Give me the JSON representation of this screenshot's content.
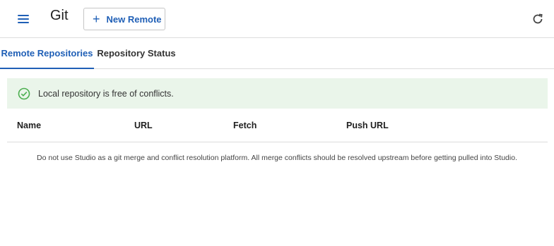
{
  "header": {
    "menu_icon": "hamburger-menu-icon",
    "title": "Git",
    "new_remote_icon": "plus-icon",
    "new_remote_label": "New Remote",
    "refresh_icon": "refresh-icon"
  },
  "tabs": [
    {
      "label": "Remote Repositories",
      "active": true
    },
    {
      "label": "Repository Status",
      "active": false
    }
  ],
  "alert": {
    "icon": "check-circle-icon",
    "message": "Local repository is free of conflicts.",
    "color": "#4caf50"
  },
  "table": {
    "columns": [
      "Name",
      "URL",
      "Fetch",
      "Push URL"
    ],
    "rows": []
  },
  "note": "Do not use Studio as a git merge and conflict resolution platform. All merge conflicts should be resolved upstream before getting pulled into Studio.",
  "colors": {
    "accent": "#1f5fb6",
    "alert_bg": "#eaf5ea",
    "divider": "#dcdcdc"
  }
}
